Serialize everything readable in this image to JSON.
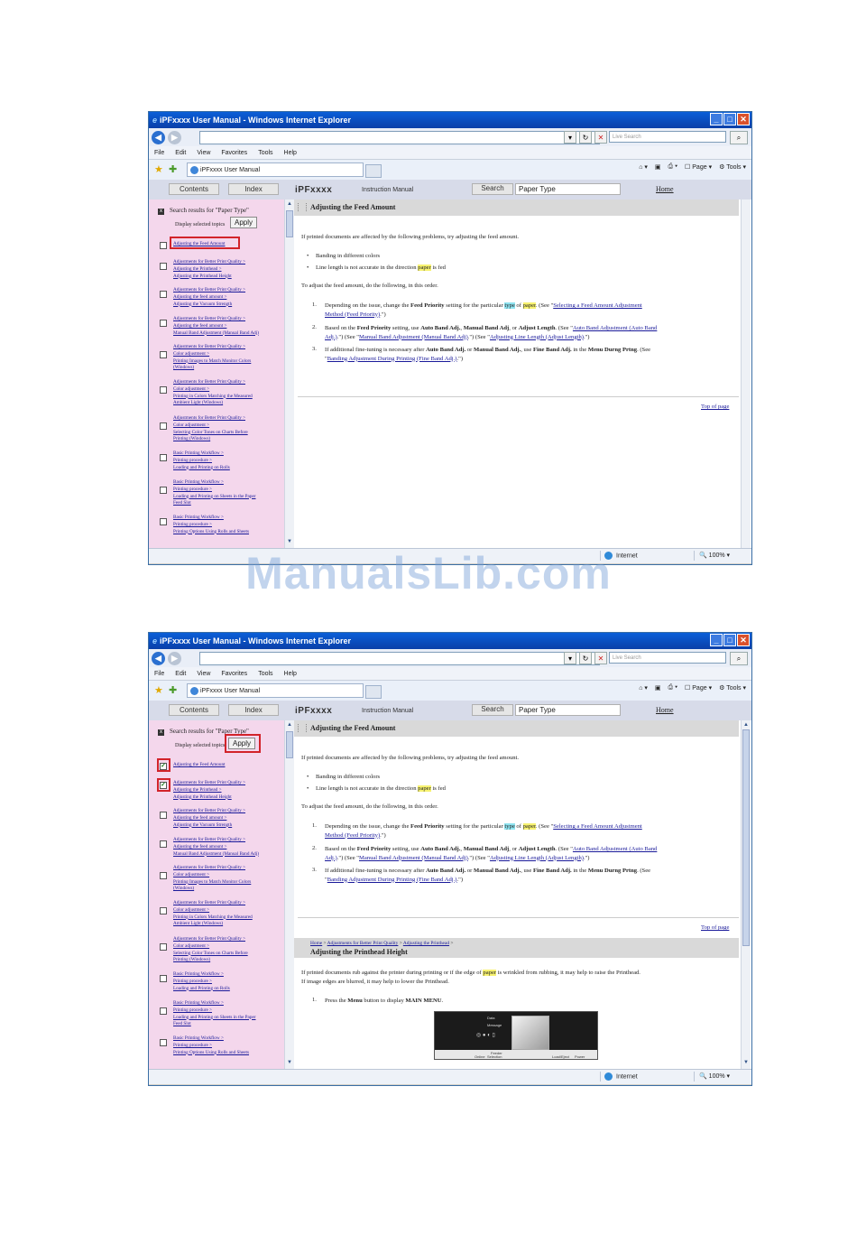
{
  "window": {
    "title": "iPFxxxx User Manual - Windows Internet Explorer",
    "search_placeholder": "Live Search"
  },
  "menu": [
    "File",
    "Edit",
    "View",
    "Favorites",
    "Tools",
    "Help"
  ],
  "tab_title": "iPFxxxx User Manual",
  "commands": {
    "home": "▾",
    "page": "Page",
    "tools": "Tools"
  },
  "nav": {
    "contents": "Contents",
    "index": "Index",
    "brand": "iPFxxxx",
    "brand_sub": "Instruction Manual",
    "search_button": "Search",
    "search_value": "Paper Type",
    "home": "Home"
  },
  "sidebar": {
    "heading": "Search results for \"Paper Type\"",
    "display_label": "Display selected topics",
    "apply": "Apply",
    "results": [
      [
        "Adjusting the Feed Amount"
      ],
      [
        "Adjustments for Better Print Quality >",
        "Adjusting the Printhead >",
        "Adjusting the Printhead Height"
      ],
      [
        "Adjustments for Better Print Quality >",
        "Adjusting the feed amount >",
        "Adjusting the Vacuum Strength"
      ],
      [
        "Adjustments for Better Print Quality >",
        "Adjusting the feed amount >",
        "Manual Band Adjustment (Manual Band Adj)"
      ],
      [
        "Adjustments for Better Print Quality >",
        "Color adjustment >",
        "Printing Images to Match Monitor Colors",
        "(Windows)"
      ],
      [
        "Adjustments for Better Print Quality >",
        "Color adjustment >",
        "Printing in Colors Matching the Measured",
        "Ambient Light (Windows)"
      ],
      [
        "Adjustments for Better Print Quality >",
        "Color adjustment >",
        "Selecting Color Tones on Charts Before",
        "Printing (Windows)"
      ],
      [
        "Basic Printing Workflow >",
        "Printing procedure >",
        "Loading and Printing on Rolls"
      ],
      [
        "Basic Printing Workflow >",
        "Printing procedure >",
        "Loading and Printing on Sheets in the Paper",
        "Feed Slot"
      ],
      [
        "Basic Printing Workflow >",
        "Printing procedure >",
        "Printing Options Using Rolls and Sheets"
      ]
    ]
  },
  "article": {
    "title": "Adjusting the Feed Amount",
    "intro": "If printed documents are affected by the following problems, try adjusting the feed amount.",
    "bullets": [
      "Banding in different colors",
      "Line length is not accurate in the direction",
      "paper",
      "is fed"
    ],
    "bullet1": "Banding in different colors",
    "bullet2_pre": "Line length is not accurate in the direction ",
    "bullet2_hl": "paper",
    "bullet2_post": " is fed",
    "todo": "To adjust the feed amount, do the following, in this order.",
    "step1_a": "Depending on the issue, change the ",
    "step1_b": "Feed Priority",
    "step1_c": " setting for the particular ",
    "step1_hl1": "type",
    "step1_d": " of ",
    "step1_hl2": "paper",
    "step1_e": ".  (See \"",
    "step1_link1": "Selecting a Feed Amount Adjustment",
    "step1_link2": "Method (Feed Priority)",
    "step1_f": ".\")",
    "step2_a": "Based on the ",
    "step2_b": "Feed Priority",
    "step2_c": " setting, use ",
    "step2_d": "Auto Band Adj.",
    "step2_e": ", ",
    "step2_f": "Manual Band Adj",
    "step2_g": ", or ",
    "step2_h": "Adjust Length",
    "step2_i": ".  (See \"",
    "step2_link1": "Auto Band Adjustment (Auto Band",
    "step2_link2": "Adj.)",
    "step2_j": ".\") (See \"",
    "step2_link3": "Manual Band Adjustment (Manual Band Adj)",
    "step2_k": ".\") (See \"",
    "step2_link4": "Adjusting Line Length (Adjust Length)",
    "step2_l": ".\")",
    "step3_a": "If additional fine-tuning is necessary after ",
    "step3_b": "Auto Band Adj.",
    "step3_c": " or ",
    "step3_d": "Manual Band Adj.",
    "step3_e": ", use ",
    "step3_f": "Fine Band Adj.",
    "step3_g": " in the ",
    "step3_h": "Menu Durng Prtng",
    "step3_i": ".  (See",
    "step3_j": "\"",
    "step3_link": "Banding Adjustment During Printing (Fine Band Adj.)",
    "step3_k": ".\")",
    "top_of_page": "Top of page"
  },
  "article2": {
    "crumb1": "Home",
    "crumb2": "Adjustments for Better Print Quality",
    "crumb3": "Adjusting the Printhead",
    "title": "Adjusting the Printhead Height",
    "p1_a": "If printed documents rub against the printer during printing or if the edge of ",
    "p1_hl": "paper",
    "p1_b": " is wrinkled from rubbing, it may help to raise the Printhead.",
    "p2": "If image edges are blurred, it may help to lower the Printhead.",
    "step1_a": "Press the ",
    "step1_b": "Menu",
    "step1_c": " button to display ",
    "step1_d": "MAIN MENU",
    "step1_e": ".",
    "panel_labels": [
      "Data",
      "Message",
      "Feeder",
      "Selection",
      "Online",
      "Load/Eject",
      "Power"
    ]
  },
  "status": {
    "zone": "Internet",
    "zoom": "100%"
  },
  "watermark": "ManualsLib.com"
}
